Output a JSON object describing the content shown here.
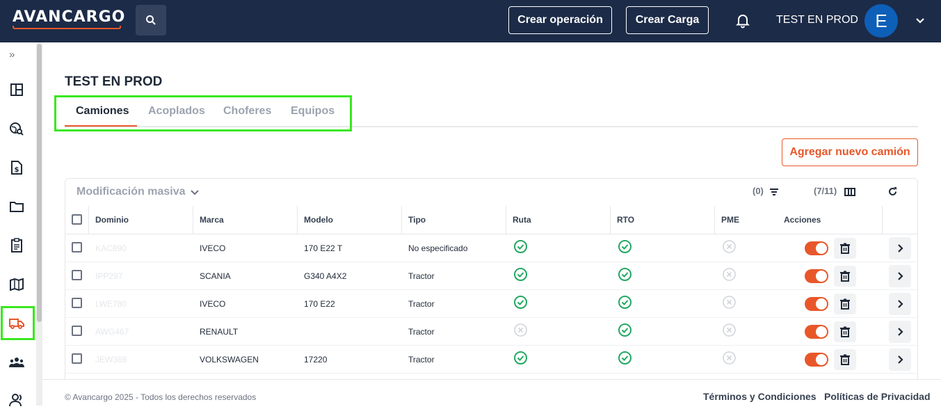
{
  "header": {
    "logo_text": "AVANCARGO",
    "create_operation_label": "Crear operación",
    "create_load_label": "Crear Carga",
    "user_name": "TEST EN PROD",
    "avatar_initial": "E"
  },
  "sidebar": {
    "expand_glyph": "»",
    "items": [
      {
        "icon": "dashboard-icon"
      },
      {
        "icon": "globe-search-icon"
      },
      {
        "icon": "invoice-icon"
      },
      {
        "icon": "folder-icon"
      },
      {
        "icon": "clipboard-icon"
      },
      {
        "icon": "map-icon"
      },
      {
        "icon": "truck-icon",
        "active": true
      },
      {
        "icon": "team-icon"
      },
      {
        "icon": "users-icon"
      }
    ]
  },
  "page": {
    "title": "TEST EN PROD",
    "tabs": [
      {
        "label": "Camiones",
        "active": true
      },
      {
        "label": "Acoplados"
      },
      {
        "label": "Choferes"
      },
      {
        "label": "Equipos"
      }
    ],
    "add_button_label": "Agregar nuevo camión"
  },
  "table": {
    "mass_modification_label": "Modificación masiva",
    "filter_count": "(0)",
    "columns_count": "(7/11)",
    "columns": [
      "Dominio",
      "Marca",
      "Modelo",
      "Tipo",
      "Ruta",
      "RTO",
      "PME",
      "Acciones"
    ],
    "rows": [
      {
        "dominio": "KAC890",
        "marca": "IVECO",
        "modelo": "170 E22 T",
        "tipo": "No especificado",
        "ruta": "ok",
        "rto": "ok",
        "pme": "no",
        "enabled": true
      },
      {
        "dominio": "IPP297",
        "marca": "SCANIA",
        "modelo": "G340 A4X2",
        "tipo": "Tractor",
        "ruta": "ok",
        "rto": "ok",
        "pme": "no",
        "enabled": true
      },
      {
        "dominio": "LWE780",
        "marca": "IVECO",
        "modelo": "170 E22",
        "tipo": "Tractor",
        "ruta": "ok",
        "rto": "ok",
        "pme": "no",
        "enabled": true
      },
      {
        "dominio": "AWG467",
        "marca": "RENAULT",
        "modelo": "",
        "tipo": "Tractor",
        "ruta": "no",
        "rto": "ok",
        "pme": "no",
        "enabled": true
      },
      {
        "dominio": "JEW369",
        "marca": "VOLKSWAGEN",
        "modelo": "17220",
        "tipo": "Tractor",
        "ruta": "ok",
        "rto": "ok",
        "pme": "no",
        "enabled": true
      }
    ]
  },
  "footer": {
    "copyright": "© Avancargo 2025 - Todos los derechos reservados",
    "terms_label": "Términos y Condiciones",
    "privacy_label": "Políticas de Privacidad"
  },
  "colors": {
    "topbar": "#1c2b47",
    "accent": "#e8572a",
    "success": "#22a862",
    "highlight": "#39e81e"
  }
}
